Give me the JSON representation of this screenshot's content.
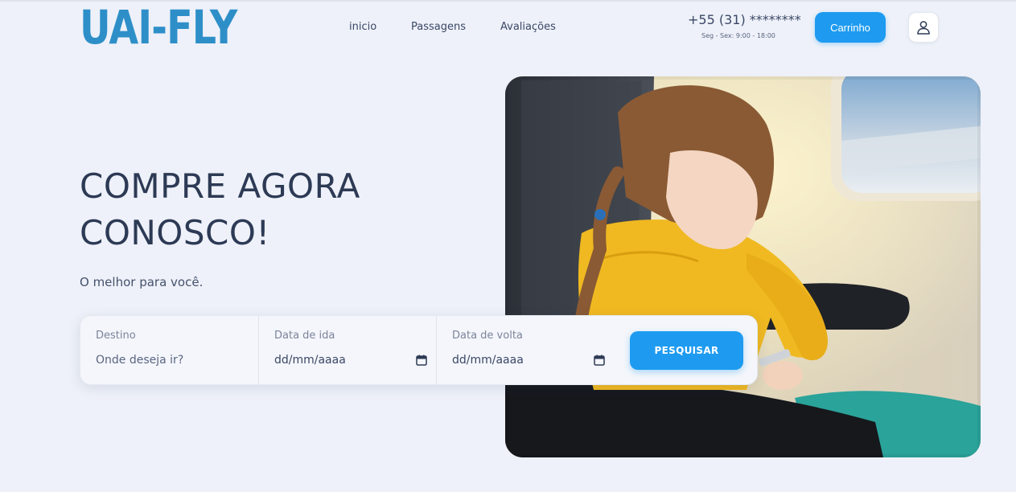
{
  "header": {
    "logo_text": "UAI-FLY",
    "nav": {
      "inicio": "inicio",
      "passagens": "Passagens",
      "avaliacoes": "Avaliações"
    },
    "phone": "+55 (31) ********",
    "hours": "Seg - Sex: 9:00 - 18:00",
    "cart_label": "Carrinho",
    "user_icon": "user-icon"
  },
  "hero": {
    "title_line1": "COMPRE AGORA",
    "title_line2": "CONOSCO!",
    "subtitle": "O melhor para você.",
    "image_description": "girl-in-yellow-sweater-fastening-seatbelt-airplane-seat"
  },
  "search": {
    "destino": {
      "label": "Destino",
      "placeholder": "Onde deseja ir?"
    },
    "data_ida": {
      "label": "Data de ida",
      "placeholder": "dd/mm/aaaa"
    },
    "data_volta": {
      "label": "Data de volta",
      "placeholder": "dd/mm/aaaa"
    },
    "button_label": "PESQUISAR"
  },
  "colors": {
    "background": "#eef1f9",
    "accent": "#1e9bf0",
    "logo": "#2e8fc8",
    "text": "#2d3a55"
  }
}
